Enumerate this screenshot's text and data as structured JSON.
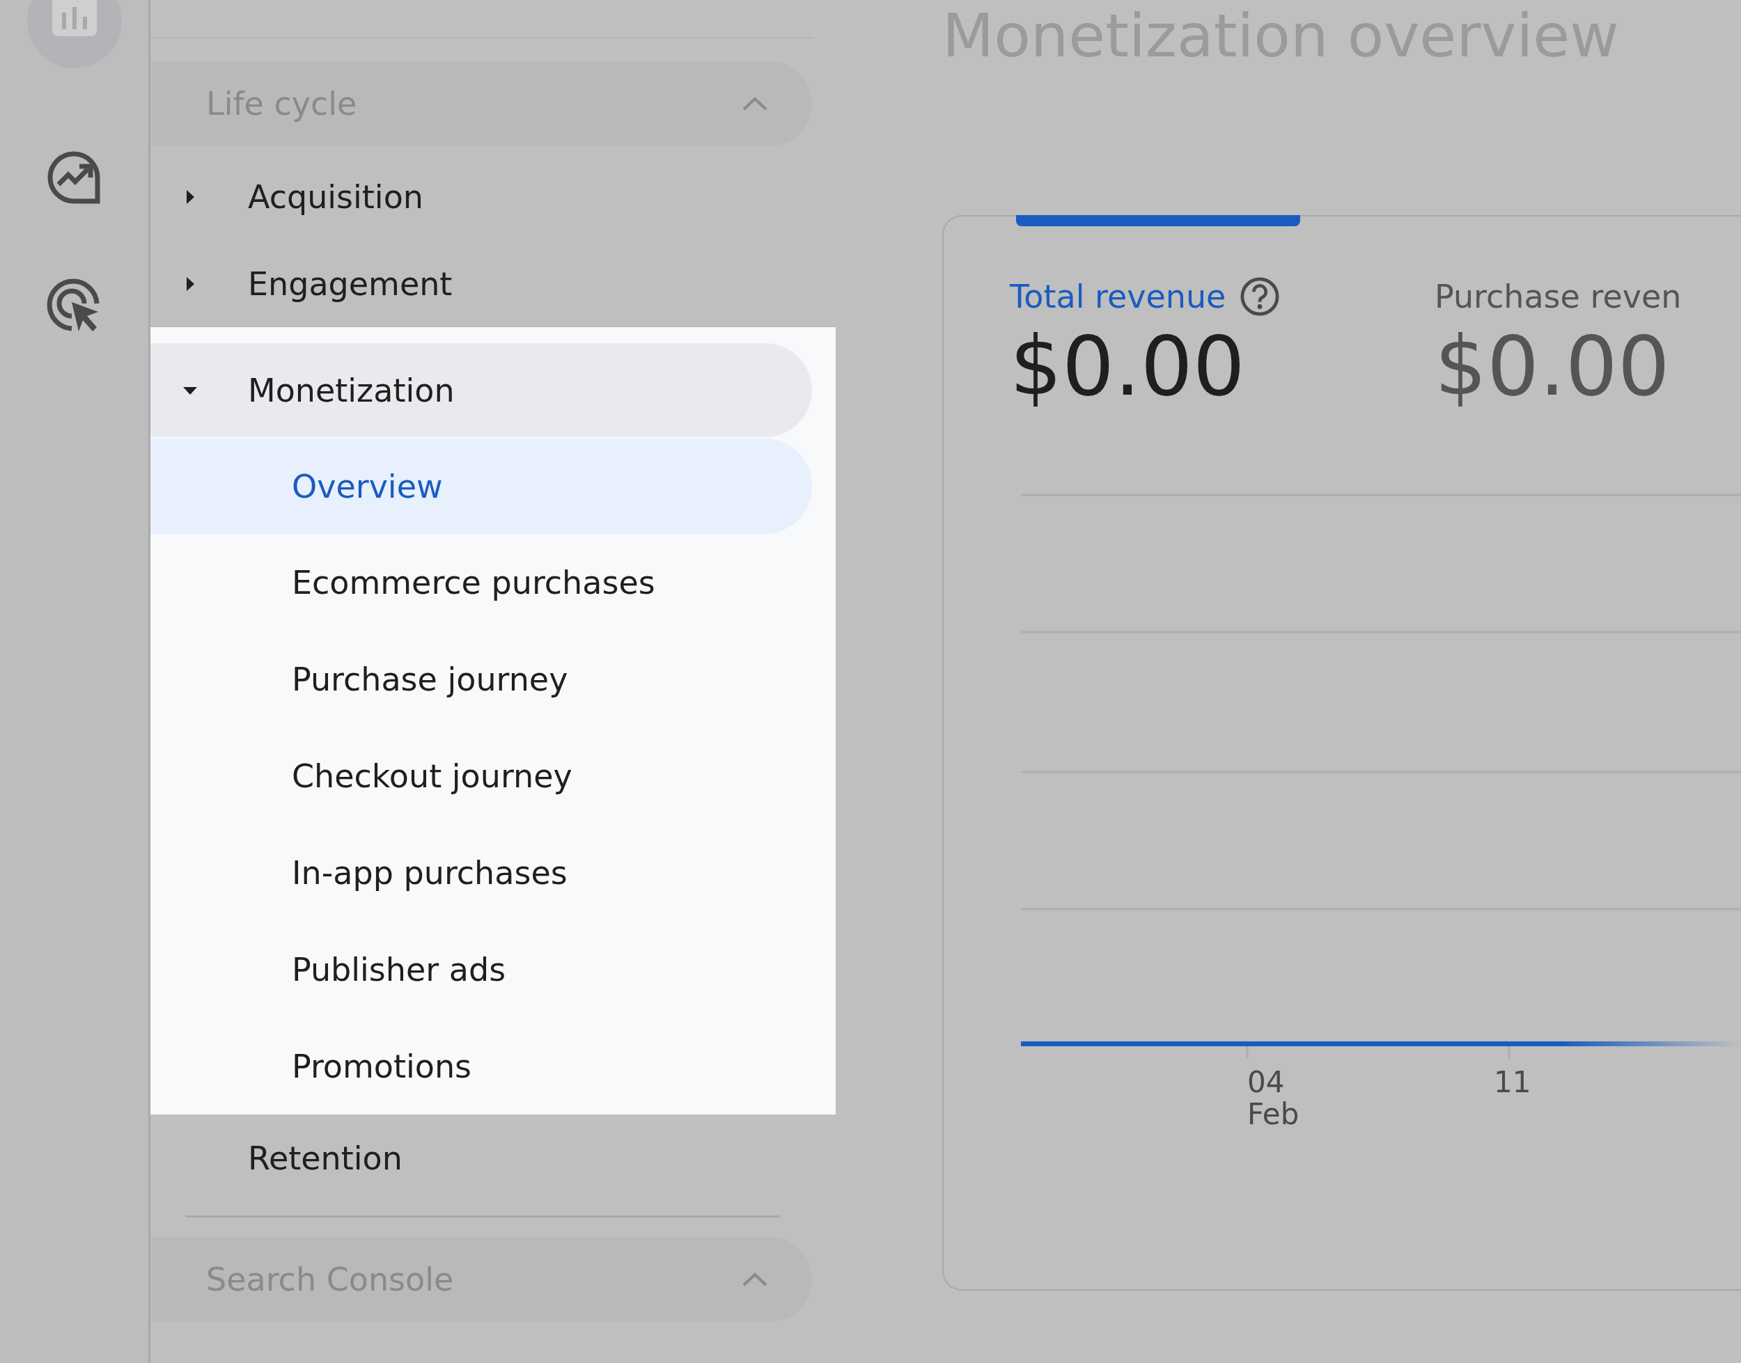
{
  "nav": {
    "sections": [
      {
        "title": "Life cycle",
        "expanded": true,
        "items": [
          {
            "label": "Acquisition",
            "expanded": false
          },
          {
            "label": "Engagement",
            "expanded": false
          },
          {
            "label": "Monetization",
            "expanded": true,
            "spotlight": true,
            "children": [
              {
                "label": "Overview",
                "selected": true
              },
              {
                "label": "Ecommerce purchases",
                "selected": false
              },
              {
                "label": "Purchase journey",
                "selected": false
              },
              {
                "label": "Checkout journey",
                "selected": false
              },
              {
                "label": "In-app purchases",
                "selected": false
              },
              {
                "label": "Publisher ads",
                "selected": false
              },
              {
                "label": "Promotions",
                "selected": false
              }
            ]
          },
          {
            "label": "Retention"
          }
        ]
      },
      {
        "title": "Search Console",
        "expanded": true
      }
    ]
  },
  "main": {
    "title": "Monetization overview",
    "metrics": [
      {
        "label": "Total revenue",
        "value": "$0.00",
        "selected": true,
        "help": true
      },
      {
        "label": "Purchase reven",
        "value": "$0.00",
        "selected": false
      }
    ],
    "axis_labels": [
      {
        "day": "04",
        "month": "Feb"
      },
      {
        "day": "11"
      }
    ]
  }
}
